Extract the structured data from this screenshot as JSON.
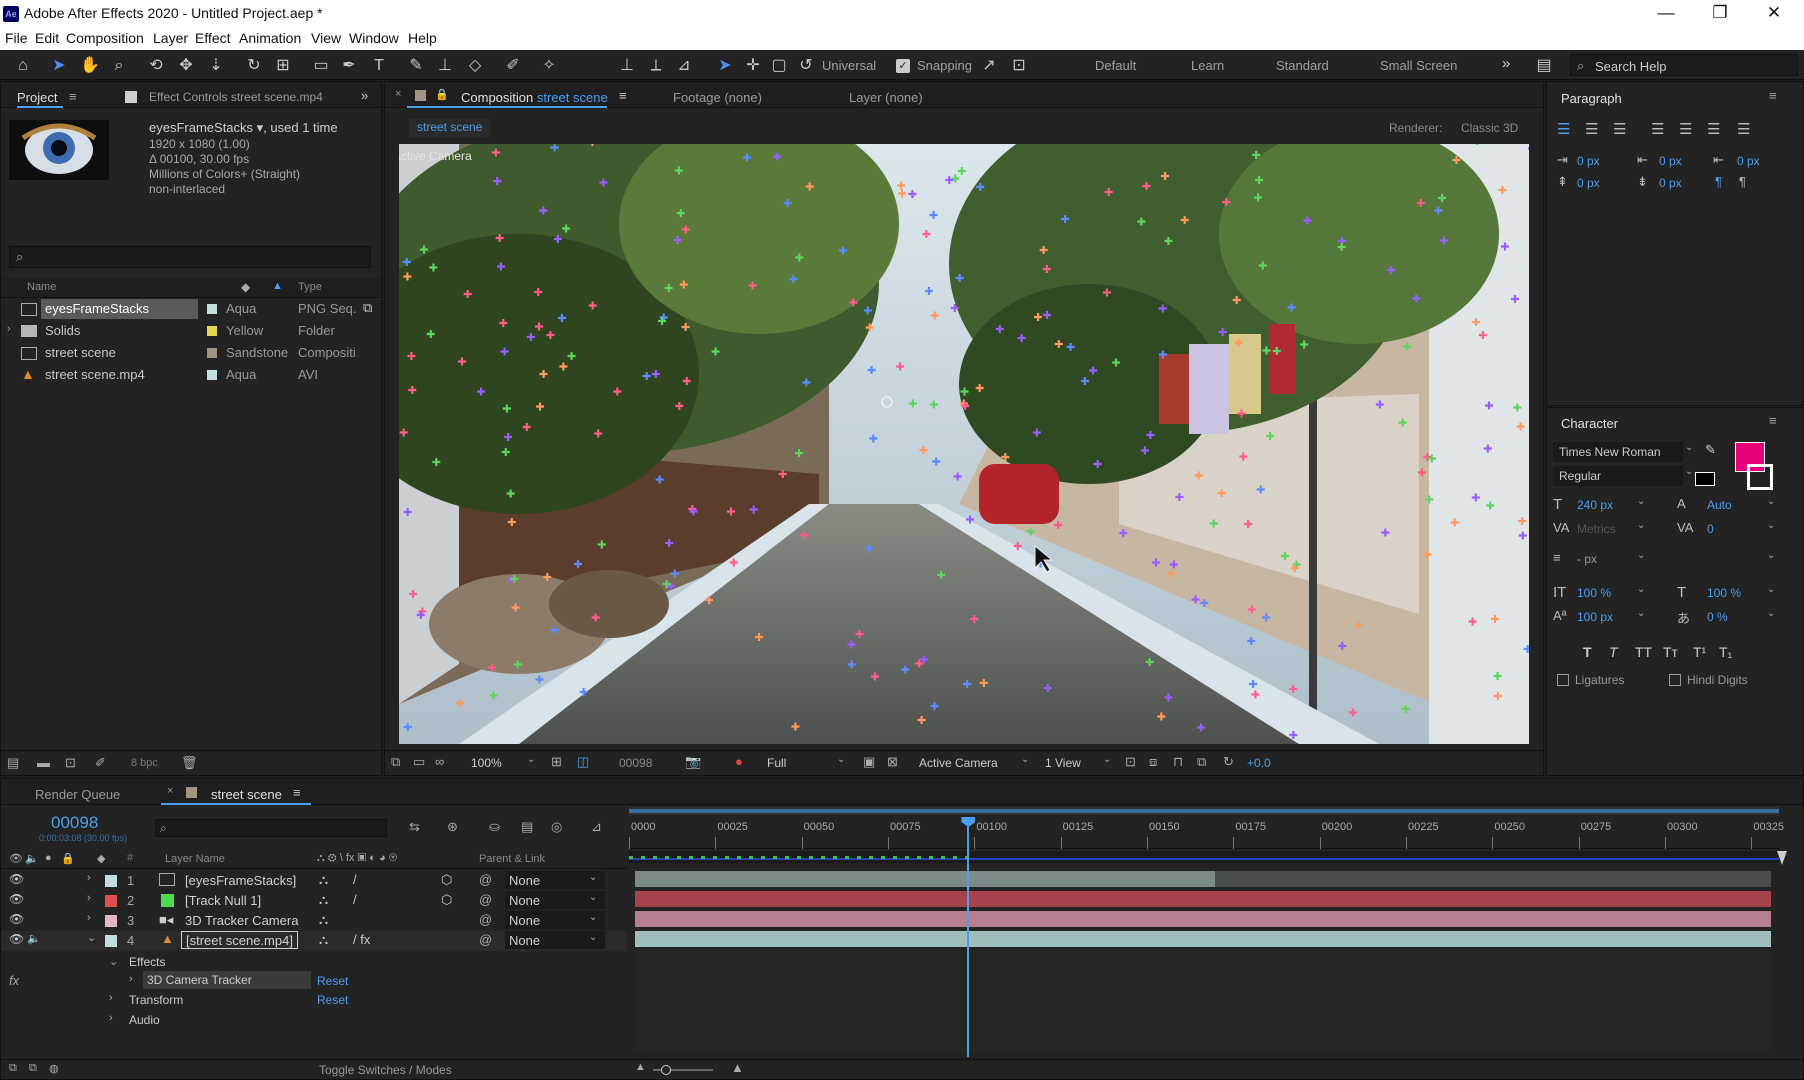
{
  "app": {
    "title": "Adobe After Effects 2020 - Untitled Project.aep *",
    "logo": "Ae"
  },
  "window_controls": {
    "minimize": "—",
    "restore": "❐",
    "close": "✕"
  },
  "menu": [
    "File",
    "Edit",
    "Composition",
    "Layer",
    "Effect",
    "Animation",
    "View",
    "Window",
    "Help"
  ],
  "toolbar": {
    "universal": "Universal",
    "snapping": "Snapping",
    "workspaces": [
      "Default",
      "Learn",
      "Standard",
      "Small Screen"
    ],
    "more": "»",
    "search_placeholder": "Search Help"
  },
  "project": {
    "tab": "Project",
    "effect_controls_tab": "Effect Controls street scene.mp4",
    "selected_name": "eyesFrameStacks ▾",
    "used": ", used 1 time",
    "info": [
      "1920 x 1080 (1.00)",
      "Δ 00100, 30.00 fps",
      "Millions of Colors+ (Straight)",
      "non-interlaced"
    ],
    "col_name": "Name",
    "col_type": "Type",
    "items": [
      {
        "name": "eyesFrameStacks",
        "label": "Aqua",
        "type": "PNG Seq.",
        "color": "#c2dede"
      },
      {
        "name": "Solids",
        "label": "Yellow",
        "type": "Folder",
        "color": "#e4d84c"
      },
      {
        "name": "street scene",
        "label": "Sandstone",
        "type": "Compositi",
        "color": "#a39582"
      },
      {
        "name": "street scene.mp4",
        "label": "Aqua",
        "type": "AVI",
        "color": "#c2dede"
      }
    ],
    "bpc": "8 bpc"
  },
  "composition": {
    "tab_prefix": "Composition",
    "tab_name": "street scene",
    "footage_tab": "Footage  (none)",
    "layer_tab": "Layer  (none)",
    "breadcrumb": "street scene",
    "renderer_label": "Renderer:",
    "renderer": "Classic 3D",
    "active_camera_label": "Active Camera",
    "zoom": "100%",
    "timecode": "00098",
    "resolution": "Full",
    "camera": "Active Camera",
    "views": "1 View",
    "exposure": "+0.0"
  },
  "paragraph": {
    "title": "Paragraph",
    "indent_left": "0 px",
    "indent_first": "0 px",
    "indent_right": "0 px",
    "space_before": "0 px",
    "space_after": "0 px"
  },
  "character": {
    "title": "Character",
    "font": "Times New Roman",
    "style": "Regular",
    "size": "240 px",
    "leading": "Auto",
    "kerning": "Metrics",
    "tracking": "0",
    "stroke": "- px",
    "vscale": "100 %",
    "hscale": "100 %",
    "baseline": "100 px",
    "tsume": "0 %",
    "fill_color": "#e8007a",
    "styles": [
      "T",
      "T",
      "TT",
      "Tт",
      "T¹",
      "T₁"
    ],
    "ligatures": "Ligatures",
    "hindi": "Hindi Digits"
  },
  "timeline": {
    "render_queue_tab": "Render Queue",
    "comp_tab": "street scene",
    "timecode": "00098",
    "sub_timecode": "0:00:03:08 (30.00 fps)",
    "col_layer_name": "Layer Name",
    "col_parent": "Parent & Link",
    "ruler": [
      "0000",
      "00025",
      "00050",
      "00075",
      "00100",
      "00125",
      "00150",
      "00175",
      "00200",
      "00225",
      "00250",
      "00275",
      "00300",
      "00325"
    ],
    "layers": [
      {
        "num": "1",
        "name": "[eyesFrameStacks]",
        "color": "#c2dede",
        "parent": "None",
        "bar": "#7c8a8a"
      },
      {
        "num": "2",
        "name": "[Track Null 1]",
        "color": "#e05050",
        "parent": "None",
        "bar": "#a5434f"
      },
      {
        "num": "3",
        "name": "3D Tracker Camera",
        "color": "#e4b6c0",
        "parent": "None",
        "bar": "#b57f8e"
      },
      {
        "num": "4",
        "name": "[street scene.mp4]",
        "color": "#c2dede",
        "parent": "None",
        "bar": "#9fbdba"
      }
    ],
    "effects": "Effects",
    "effect_name": "3D Camera Tracker",
    "reset": "Reset",
    "transform": "Transform",
    "audio": "Audio",
    "toggle": "Toggle Switches / Modes",
    "playhead_frame": 98,
    "duration_frames": 333
  }
}
